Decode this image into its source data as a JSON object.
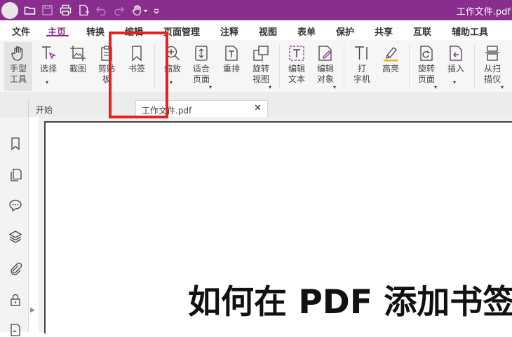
{
  "window": {
    "title": "工作文件.pdf"
  },
  "quick_access": {
    "icons": [
      "open-folder-icon",
      "save-icon",
      "print-icon",
      "new-file-icon",
      "undo-icon",
      "redo-icon",
      "hand-dropdown-icon",
      "customize-icon"
    ]
  },
  "menu": {
    "items": [
      {
        "label": "文件",
        "active": false
      },
      {
        "label": "主页",
        "active": true
      },
      {
        "label": "转换",
        "active": false
      },
      {
        "label": "编辑",
        "active": false
      },
      {
        "label": "页面管理",
        "active": false
      },
      {
        "label": "注释",
        "active": false
      },
      {
        "label": "视图",
        "active": false
      },
      {
        "label": "表单",
        "active": false
      },
      {
        "label": "保护",
        "active": false
      },
      {
        "label": "共享",
        "active": false
      },
      {
        "label": "互联",
        "active": false
      },
      {
        "label": "辅助工具",
        "active": false
      }
    ]
  },
  "ribbon": {
    "tools": [
      {
        "name": "hand-tool",
        "label": "手型\n工具",
        "icon": "hand-icon"
      },
      {
        "name": "select-tool",
        "label": "选择",
        "icon": "select-text-icon"
      },
      {
        "name": "screenshot-tool",
        "label": "截图",
        "icon": "screenshot-icon"
      },
      {
        "name": "clipboard-tool",
        "label": "剪贴\n板",
        "icon": "clipboard-icon"
      },
      {
        "name": "bookmark-tool",
        "label": "书签",
        "icon": "bookmark-icon"
      },
      {
        "name": "zoom-tool",
        "label": "缩放",
        "icon": "zoom-icon"
      },
      {
        "name": "fit-page-tool",
        "label": "适合\n页面",
        "icon": "fit-page-icon"
      },
      {
        "name": "reflow-tool",
        "label": "重排",
        "icon": "reflow-icon"
      },
      {
        "name": "rotate-view-tool",
        "label": "旋转\n视图",
        "icon": "rotate-view-icon"
      },
      {
        "name": "edit-text-tool",
        "label": "编辑\n文本",
        "icon": "edit-text-icon"
      },
      {
        "name": "edit-object-tool",
        "label": "编辑\n对象",
        "icon": "edit-object-icon"
      },
      {
        "name": "typewriter-tool",
        "label": "打\n字机",
        "icon": "typewriter-icon"
      },
      {
        "name": "highlight-tool",
        "label": "高亮",
        "icon": "highlighter-icon"
      },
      {
        "name": "rotate-page-tool",
        "label": "旋转\n页面",
        "icon": "rotate-page-icon"
      },
      {
        "name": "insert-tool",
        "label": "插入",
        "icon": "insert-page-icon"
      },
      {
        "name": "scan-tool",
        "label": "从扫\n描仪",
        "icon": "scanner-icon"
      }
    ]
  },
  "tabs": {
    "home": "开始",
    "document": "工作文件.pdf",
    "close_symbol": "✕"
  },
  "sidebar": {
    "icons": [
      "bookmark-panel-icon",
      "pages-panel-icon",
      "comments-panel-icon",
      "layers-panel-icon",
      "attachments-panel-icon",
      "security-panel-icon",
      "signature-panel-icon"
    ],
    "collapse_symbol": "▶"
  },
  "document": {
    "heading": "如何在 PDF 添加书签"
  },
  "colors": {
    "titlebar": "#8a2e8e",
    "accent": "#8a2e8e",
    "highlight_box": "#e82020"
  }
}
